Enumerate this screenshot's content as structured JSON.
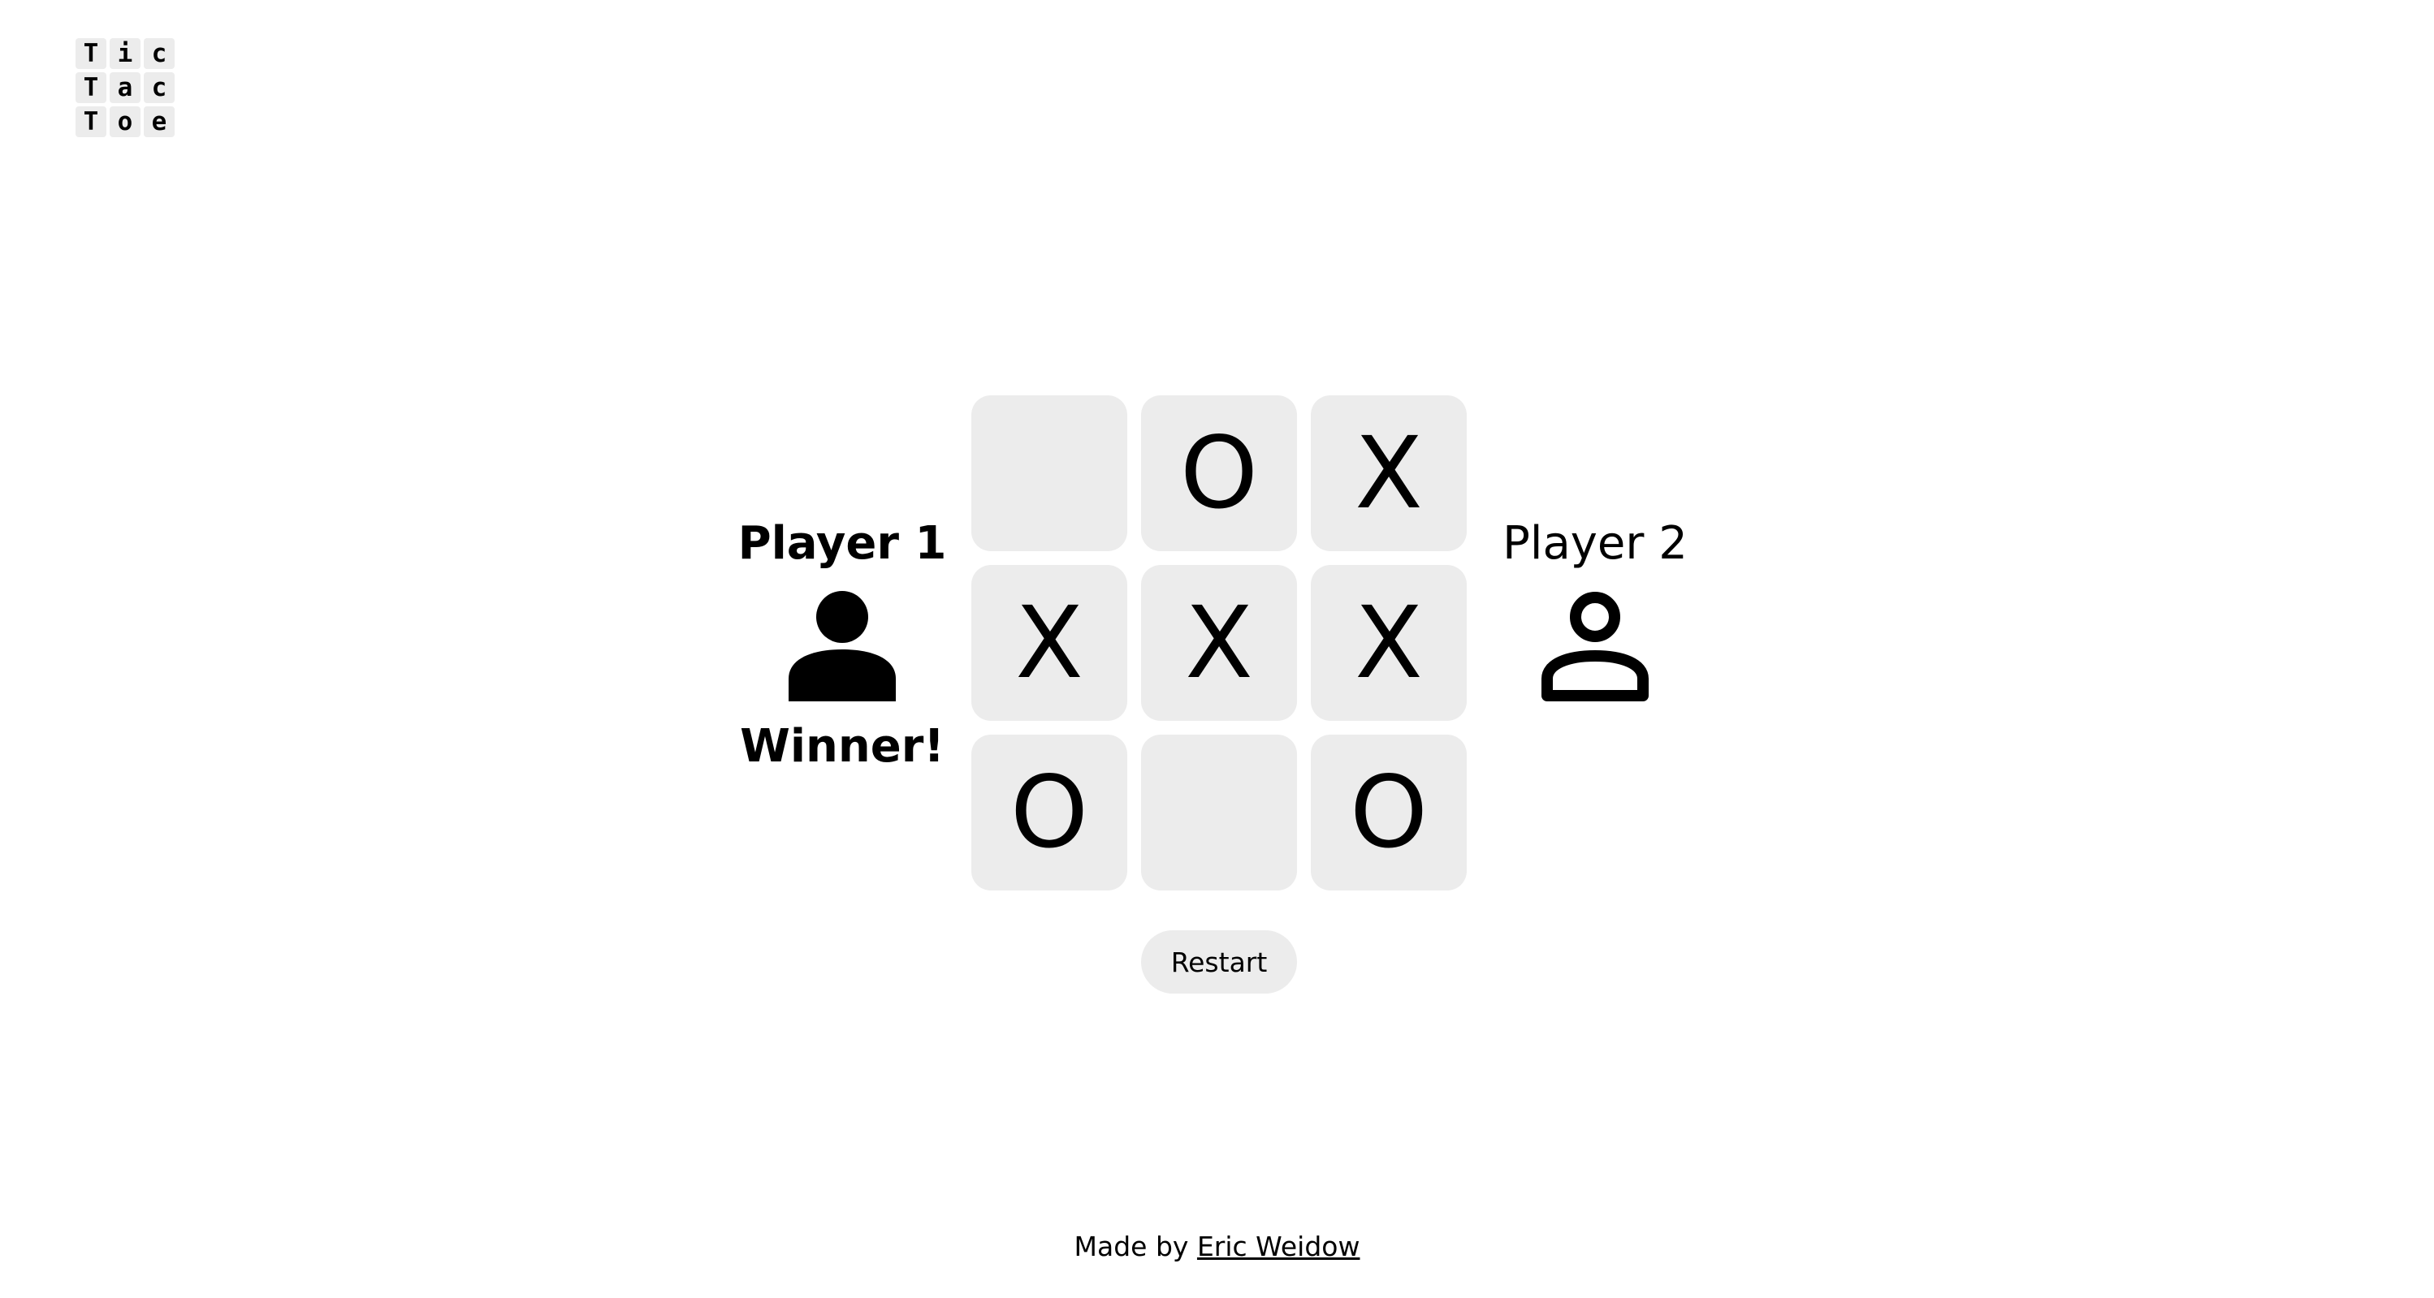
{
  "logo": {
    "letters": [
      "T",
      "i",
      "c",
      "T",
      "a",
      "c",
      "T",
      "o",
      "e"
    ]
  },
  "players": [
    {
      "name": "Player 1",
      "icon": "person-filled-icon",
      "status": "Winner!",
      "is_active": true
    },
    {
      "name": "Player 2",
      "icon": "person-outline-icon",
      "status": "",
      "is_active": false
    }
  ],
  "board": {
    "cells": [
      "",
      "O",
      "X",
      "X",
      "X",
      "X",
      "O",
      "",
      "O"
    ]
  },
  "controls": {
    "restart_label": "Restart"
  },
  "footer": {
    "prefix": "Made by",
    "author": "Eric Weidow"
  },
  "colors": {
    "cell_background": "#ececec",
    "text": "#000000",
    "page_background": "#ffffff"
  }
}
